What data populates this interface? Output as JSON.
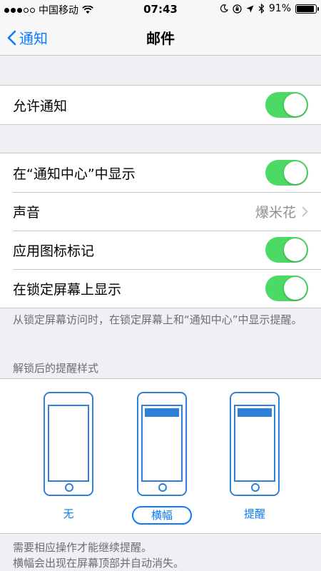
{
  "status_bar": {
    "carrier": "中国移动",
    "time": "07:43",
    "battery": "91%",
    "battery_level": 0.91
  },
  "nav": {
    "back_label": "通知",
    "title": "邮件"
  },
  "allow_notifications": {
    "label": "允许通知",
    "on": true
  },
  "settings": [
    {
      "label": "在“通知中心”中显示",
      "type": "toggle",
      "on": true
    },
    {
      "label": "声音",
      "type": "detail",
      "value": "爆米花"
    },
    {
      "label": "应用图标标记",
      "type": "toggle",
      "on": true
    },
    {
      "label": "在锁定屏幕上显示",
      "type": "toggle",
      "on": true
    }
  ],
  "lock_screen_footnote": "从锁定屏幕访问时，在锁定屏幕上和“通知中心”中显示提醒。",
  "alert_style": {
    "header": "解锁后的提醒样式",
    "options": [
      {
        "label": "无",
        "selected": false
      },
      {
        "label": "横幅",
        "selected": true
      },
      {
        "label": "提醒",
        "selected": false
      }
    ]
  },
  "alert_footnote": {
    "line1": "需要相应操作才能继续提醒。",
    "line2": "横幅会出现在屏幕顶部并自动消失。"
  },
  "colors": {
    "accent": "#0a7aff",
    "toggle_on": "#4cd964",
    "phone_outline": "#2f80d6",
    "background": "#efeff4"
  }
}
